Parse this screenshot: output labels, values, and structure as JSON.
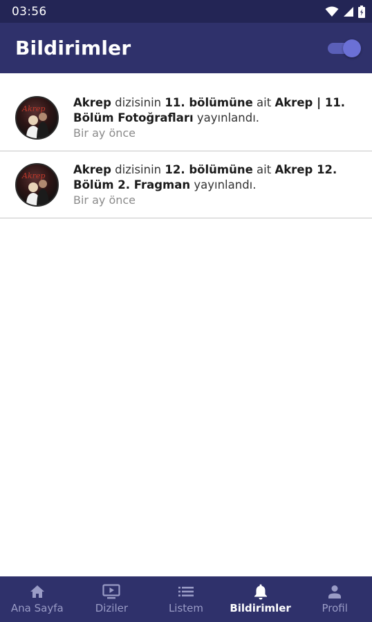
{
  "status_bar": {
    "time": "03:56",
    "icons": [
      "wifi-icon",
      "cell-signal-icon",
      "battery-icon"
    ]
  },
  "app_bar": {
    "title": "Bildirimler",
    "notifications_toggle_on": true
  },
  "notifications": [
    {
      "show": "Akrep",
      "t1": " dizisinin ",
      "episode": "11. bölümüne",
      "t2": " ait ",
      "content": "Akrep | 11. Bölüm Fotoğrafları",
      "t3": " yayınlandı.",
      "time": "Bir ay önce"
    },
    {
      "show": "Akrep",
      "t1": " dizisinin ",
      "episode": "12. bölümüne",
      "t2": " ait ",
      "content": "Akrep 12. Bölüm 2. Fragman",
      "t3": " yayınlandı.",
      "time": "Bir ay önce"
    }
  ],
  "bottom_nav": {
    "items": [
      {
        "label": "Ana Sayfa",
        "icon": "home-icon",
        "active": false
      },
      {
        "label": "Diziler",
        "icon": "tv-icon",
        "active": false
      },
      {
        "label": "Listem",
        "icon": "list-icon",
        "active": false
      },
      {
        "label": "Bildirimler",
        "icon": "bell-icon",
        "active": true
      },
      {
        "label": "Profil",
        "icon": "person-icon",
        "active": false
      }
    ]
  },
  "colors": {
    "status_bar": "#232555",
    "app_bar": "#2f316b",
    "toggle": "#6b70d6",
    "nav_inactive": "#9a9cc6",
    "nav_active": "#ffffff"
  }
}
